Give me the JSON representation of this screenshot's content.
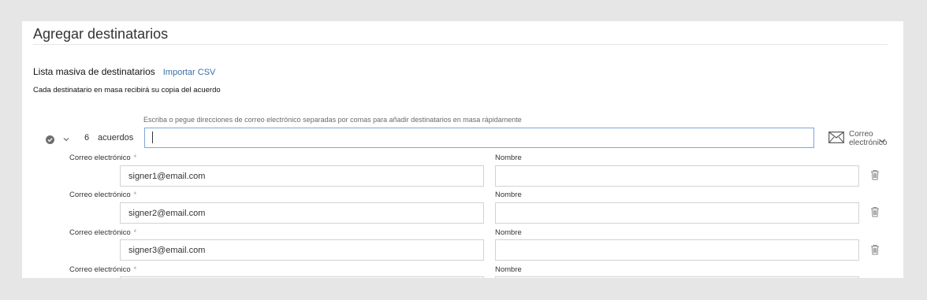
{
  "page": {
    "title": "Agregar destinatarios"
  },
  "bulk_list": {
    "label": "Lista masiva de destinatarios",
    "import_link": "Importar CSV",
    "subtitle": "Cada destinatario en masa recibirá su copia del acuerdo",
    "hint": "Escriba o pegue direcciones de correo electrónico separadas por comas para añadir destinatarios en masa rápidamente",
    "input_value": "",
    "count": "6",
    "count_label": "acuerdos",
    "delivery_method_line1": "Correo",
    "delivery_method_line2": "electrónico"
  },
  "recipients": [
    {
      "email_label": "Correo electrónico",
      "required_mark": "*",
      "email": "signer1@email.com",
      "name_label": "Nombre",
      "name": ""
    },
    {
      "email_label": "Correo electrónico",
      "required_mark": "*",
      "email": "signer2@email.com",
      "name_label": "Nombre",
      "name": ""
    },
    {
      "email_label": "Correo electrónico",
      "required_mark": "*",
      "email": "signer3@email.com",
      "name_label": "Nombre",
      "name": ""
    },
    {
      "email_label": "Correo electrónico",
      "required_mark": "*",
      "email": "",
      "name_label": "Nombre",
      "name": ""
    }
  ],
  "colors": {
    "background": "#e6e6e6",
    "panel": "#ffffff",
    "link": "#3a6ea5",
    "input_focus_border": "#7ea6d6"
  },
  "icons": [
    "check-circle-icon",
    "chevron-down-icon",
    "envelope-icon",
    "trash-icon"
  ]
}
